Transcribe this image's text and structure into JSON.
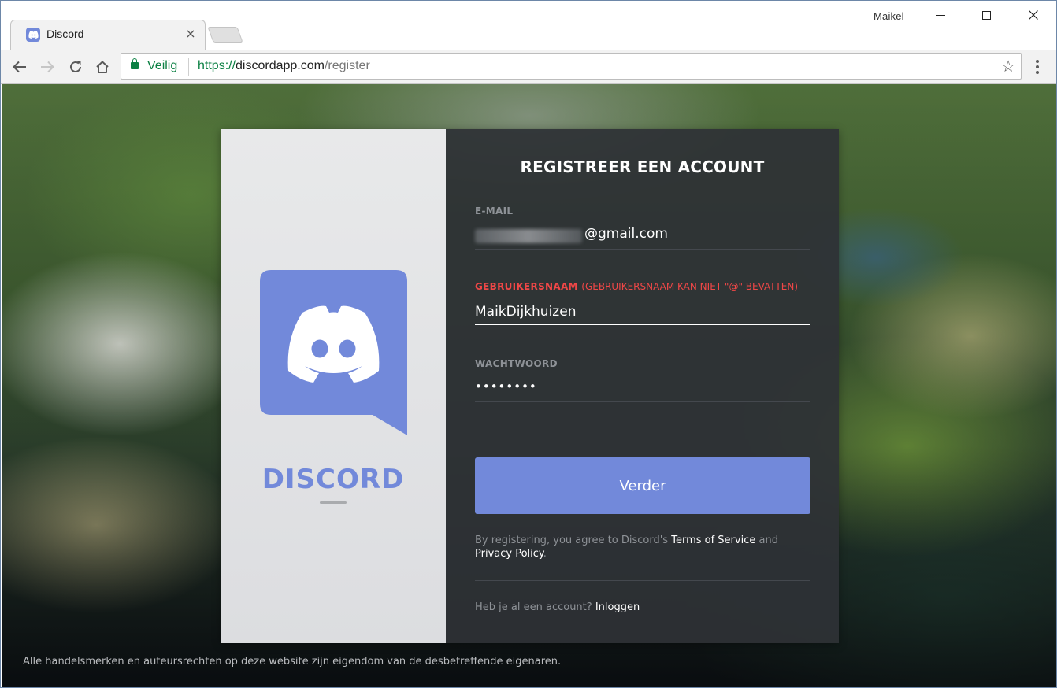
{
  "browser": {
    "tab_title": "Discord",
    "tab_close": "×",
    "profile_name": "Maikel",
    "secure_label": "Veilig",
    "url_scheme": "https://",
    "url_host": "discordapp.com",
    "url_path": "/register"
  },
  "brand": {
    "wordmark": "DISCORD",
    "accent_color": "#7289da"
  },
  "form": {
    "title": "REGISTREER EEN ACCOUNT",
    "email": {
      "label": "E-MAIL",
      "value_visible_suffix": "@gmail.com"
    },
    "username": {
      "label": "GEBRUIKERSNAAM",
      "error_hint": "(GEBRUIKERSNAAM KAN NIET \"@\" BEVATTEN)",
      "value": "MaikDijkhuizen"
    },
    "password": {
      "label": "WACHTWOORD",
      "masked_value": "••••••••"
    },
    "submit_label": "Verder",
    "terms": {
      "prefix": "By registering, you agree to Discord's",
      "tos_link": "Terms of Service",
      "and": "and",
      "privacy_link": "Privacy Policy",
      "suffix": "."
    },
    "login_prompt": "Heb je al een account?",
    "login_link": "Inloggen",
    "error_color": "#f04747"
  },
  "footer": {
    "note": "Alle handelsmerken en auteursrechten op deze website zijn eigendom van de desbetreffende eigenaren."
  }
}
